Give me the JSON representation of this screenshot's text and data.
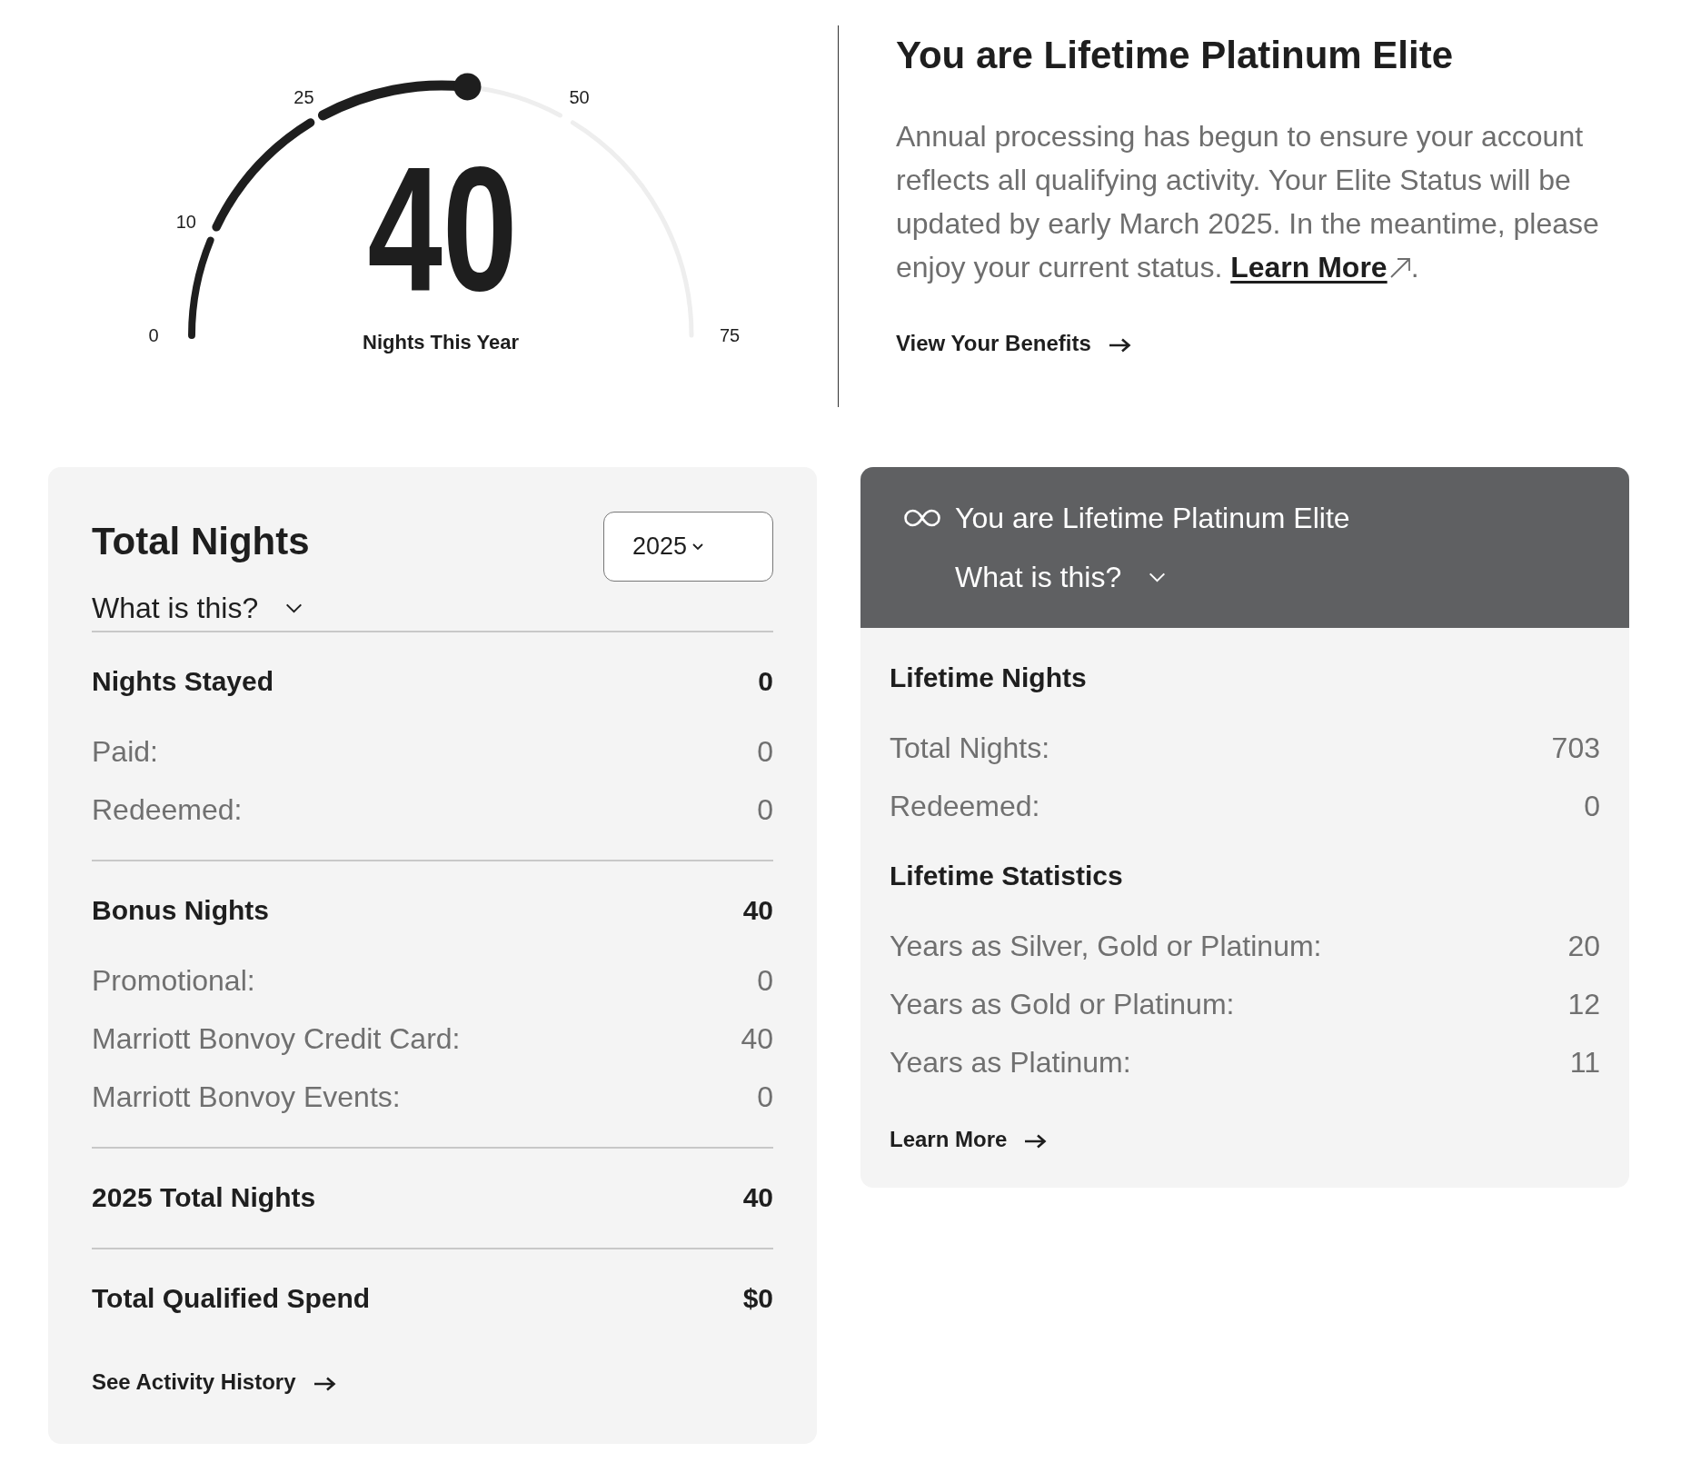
{
  "gauge": {
    "value": "40",
    "label": "Nights This Year",
    "level": 0.533,
    "ticks": [
      "0",
      "10",
      "25",
      "50",
      "75"
    ]
  },
  "status": {
    "title": "You are Lifetime Platinum Elite",
    "message": "Annual processing has begun to ensure your account reflects all qualifying activity. Your Elite Status will be updated by early March 2025. In the meantime, please enjoy your current status.",
    "link": "Learn More",
    "message_end": ".",
    "action": "View Your Benefits"
  },
  "total_nights_card": {
    "title": "Total Nights",
    "help": {
      "label": "What is this?",
      "expanded": false
    },
    "year_select": {
      "value": "2025"
    },
    "sections": [
      {
        "heading": "Nights Stayed",
        "total": "0",
        "rows": [
          {
            "label": "Paid:",
            "value": "0"
          },
          {
            "label": "Redeemed:",
            "value": "0"
          }
        ]
      },
      {
        "heading": "Bonus Nights",
        "total": "40",
        "rows": [
          {
            "label": "Promotional:",
            "value": "0"
          },
          {
            "label": "Marriott Bonvoy Credit Card:",
            "value": "40"
          },
          {
            "label": "Marriott Bonvoy Events:",
            "value": "0"
          }
        ]
      },
      {
        "heading": "2025 Total Nights",
        "total": "40"
      },
      {
        "heading": "Total Qualified Spend",
        "total": "$0"
      }
    ],
    "action": "See Activity History"
  },
  "lifetime_card": {
    "title": "You are Lifetime Platinum Elite",
    "help": {
      "label": "What is this?",
      "expanded": false
    },
    "sections": [
      {
        "heading": "Lifetime Nights",
        "rows": [
          {
            "label": "Total Nights:",
            "value": "703"
          },
          {
            "label": "Redeemed:",
            "value": "0"
          }
        ]
      },
      {
        "heading": "Lifetime Statistics",
        "rows": [
          {
            "label": "Years as Silver, Gold or Platinum:",
            "value": "20"
          },
          {
            "label": "Years as Gold or Platinum:",
            "value": "12"
          },
          {
            "label": "Years as Platinum:",
            "value": "11"
          }
        ]
      }
    ],
    "action": "Learn More"
  }
}
